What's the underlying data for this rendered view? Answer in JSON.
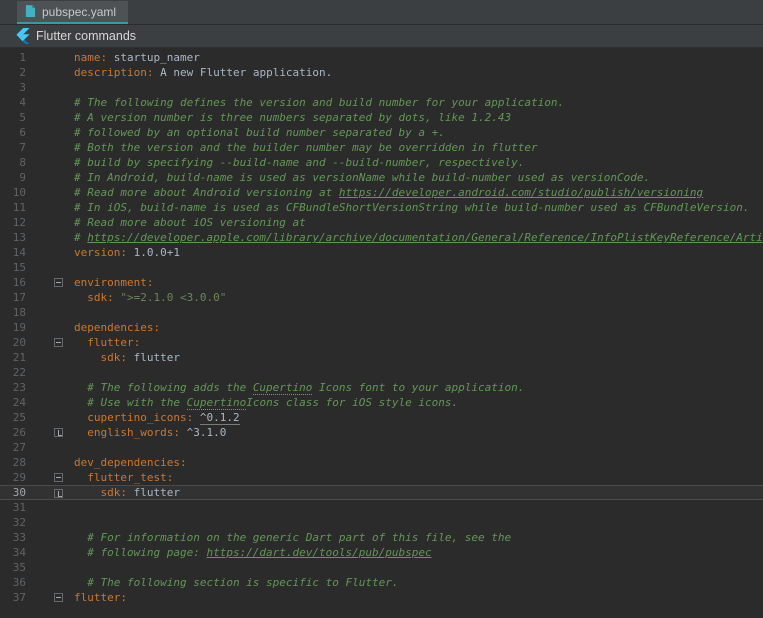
{
  "colors": {
    "editor_bg": "#2b2b2b",
    "chrome_bg": "#3c3f41",
    "tab_active_bg": "#4e5254",
    "gutter_number": "#606366",
    "caret_line_bg": "#323232",
    "key": "#cb772f",
    "text": "#a9b7c6",
    "comment": "#629755",
    "string": "#6a8759",
    "flutter_blue": "#45c9f4"
  },
  "tab_bar": {
    "tabs": [
      {
        "label": "pubspec.yaml",
        "active": true
      }
    ]
  },
  "banner": {
    "title": "Flutter commands"
  },
  "editor": {
    "lines": [
      {
        "n": 1,
        "segs": [
          {
            "c": "key",
            "t": "name:"
          },
          {
            "c": "text",
            "t": " startup_namer"
          }
        ]
      },
      {
        "n": 2,
        "segs": [
          {
            "c": "key",
            "t": "description:"
          },
          {
            "c": "text",
            "t": " A new Flutter application."
          }
        ]
      },
      {
        "n": 3,
        "segs": []
      },
      {
        "n": 4,
        "segs": [
          {
            "c": "comment",
            "t": "# The following defines the version and build number for your application."
          }
        ]
      },
      {
        "n": 5,
        "segs": [
          {
            "c": "comment",
            "t": "# A version number is three numbers separated by dots, like 1.2.43"
          }
        ]
      },
      {
        "n": 6,
        "segs": [
          {
            "c": "comment",
            "t": "# followed by an optional build number separated by a +."
          }
        ]
      },
      {
        "n": 7,
        "segs": [
          {
            "c": "comment",
            "t": "# Both the version and the builder number may be overridden in flutter"
          }
        ]
      },
      {
        "n": 8,
        "segs": [
          {
            "c": "comment",
            "t": "# build by specifying --build-name and --build-number, respectively."
          }
        ]
      },
      {
        "n": 9,
        "segs": [
          {
            "c": "comment",
            "t": "# In Android, build-name is used as versionName while build-number used as versionCode."
          }
        ]
      },
      {
        "n": 10,
        "segs": [
          {
            "c": "comment",
            "t": "# Read more about Android versioning at "
          },
          {
            "c": "link",
            "t": "https://developer.android.com/studio/publish/versioning"
          }
        ]
      },
      {
        "n": 11,
        "segs": [
          {
            "c": "comment",
            "t": "# In iOS, build-name is used as CFBundleShortVersionString while build-number used as CFBundleVersion."
          }
        ]
      },
      {
        "n": 12,
        "segs": [
          {
            "c": "comment",
            "t": "# Read more about iOS versioning at"
          }
        ]
      },
      {
        "n": 13,
        "segs": [
          {
            "c": "comment",
            "t": "# "
          },
          {
            "c": "link",
            "t": "https://developer.apple.com/library/archive/documentation/General/Reference/InfoPlistKeyReference/Articles/AboutInformationPropertyListFiles.html"
          }
        ]
      },
      {
        "n": 14,
        "segs": [
          {
            "c": "key",
            "t": "version:"
          },
          {
            "c": "text",
            "t": " 1.0.0+1"
          }
        ]
      },
      {
        "n": 15,
        "segs": []
      },
      {
        "n": 16,
        "fold": "start",
        "segs": [
          {
            "c": "key",
            "t": "environment:"
          }
        ]
      },
      {
        "n": 17,
        "segs": [
          {
            "c": "key",
            "t": "  sdk:"
          },
          {
            "c": "string",
            "t": " \">=2.1.0 <3.0.0\""
          }
        ]
      },
      {
        "n": 18,
        "segs": []
      },
      {
        "n": 19,
        "segs": [
          {
            "c": "key",
            "t": "dependencies:"
          }
        ]
      },
      {
        "n": 20,
        "fold": "start",
        "segs": [
          {
            "c": "key",
            "t": "  flutter:"
          }
        ]
      },
      {
        "n": 21,
        "segs": [
          {
            "c": "key",
            "t": "    sdk:"
          },
          {
            "c": "text",
            "t": " flutter"
          }
        ]
      },
      {
        "n": 22,
        "segs": []
      },
      {
        "n": 23,
        "segs": [
          {
            "c": "comment",
            "t": "  # The following adds the "
          },
          {
            "c": "typo",
            "t": "Cupertino"
          },
          {
            "c": "comment",
            "t": " Icons font to your application."
          }
        ]
      },
      {
        "n": 24,
        "segs": [
          {
            "c": "comment",
            "t": "  # Use with the "
          },
          {
            "c": "typo",
            "t": "Cupertino"
          },
          {
            "c": "comment",
            "t": "Icons class for iOS style icons."
          }
        ]
      },
      {
        "n": 25,
        "segs": [
          {
            "c": "key",
            "t": "  cupertino_icons:"
          },
          {
            "c": "text",
            "t": " "
          },
          {
            "c": "ver",
            "t": "^0.1.2"
          }
        ]
      },
      {
        "n": 26,
        "fold": "end",
        "segs": [
          {
            "c": "key",
            "t": "  english_words:"
          },
          {
            "c": "text",
            "t": " ^3.1.0"
          }
        ]
      },
      {
        "n": 27,
        "segs": []
      },
      {
        "n": 28,
        "segs": [
          {
            "c": "key",
            "t": "dev_dependencies:"
          }
        ]
      },
      {
        "n": 29,
        "fold": "start",
        "segs": [
          {
            "c": "key",
            "t": "  flutter_test:"
          }
        ]
      },
      {
        "n": 30,
        "fold": "end",
        "caret": true,
        "segs": [
          {
            "c": "key",
            "t": "    sdk:"
          },
          {
            "c": "text",
            "t": " flutter"
          }
        ]
      },
      {
        "n": 31,
        "segs": []
      },
      {
        "n": 32,
        "segs": []
      },
      {
        "n": 33,
        "segs": [
          {
            "c": "comment",
            "t": "  # For information on the generic Dart part of this file, see the"
          }
        ]
      },
      {
        "n": 34,
        "segs": [
          {
            "c": "comment",
            "t": "  # following page: "
          },
          {
            "c": "link",
            "t": "https://dart.dev/tools/pub/pubspec"
          }
        ]
      },
      {
        "n": 35,
        "segs": []
      },
      {
        "n": 36,
        "segs": [
          {
            "c": "comment",
            "t": "  # The following section is specific to Flutter."
          }
        ]
      },
      {
        "n": 37,
        "fold": "start",
        "segs": [
          {
            "c": "key",
            "t": "flutter:"
          }
        ]
      }
    ]
  }
}
